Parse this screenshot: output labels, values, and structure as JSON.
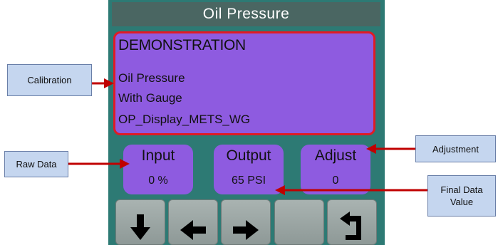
{
  "screen": {
    "title": "Oil Pressure",
    "main": {
      "mode": "DEMONSTRATION",
      "line1": "Oil Pressure",
      "line2": "With Gauge",
      "line3": "OP_Display_METS_WG"
    },
    "params": [
      {
        "label": "Input",
        "value": "0 %"
      },
      {
        "label": "Output",
        "value": "65 PSI"
      },
      {
        "label": "Adjust",
        "value": "0"
      }
    ],
    "softkeys": [
      {
        "icon": "arrow-down-icon"
      },
      {
        "icon": "arrow-left-icon"
      },
      {
        "icon": "arrow-right-icon"
      },
      {
        "icon": "blank"
      },
      {
        "icon": "return-icon"
      }
    ]
  },
  "callouts": {
    "calibration": "Calibration",
    "raw_data": "Raw Data",
    "adjustment": "Adjustment",
    "final_data_value": "Final Data Value"
  },
  "colors": {
    "panel": "#8e5be0",
    "highlight": "#e01b24",
    "bezel": "#2d7a74",
    "callout": "#c5d6ef",
    "arrow": "#c00000"
  }
}
